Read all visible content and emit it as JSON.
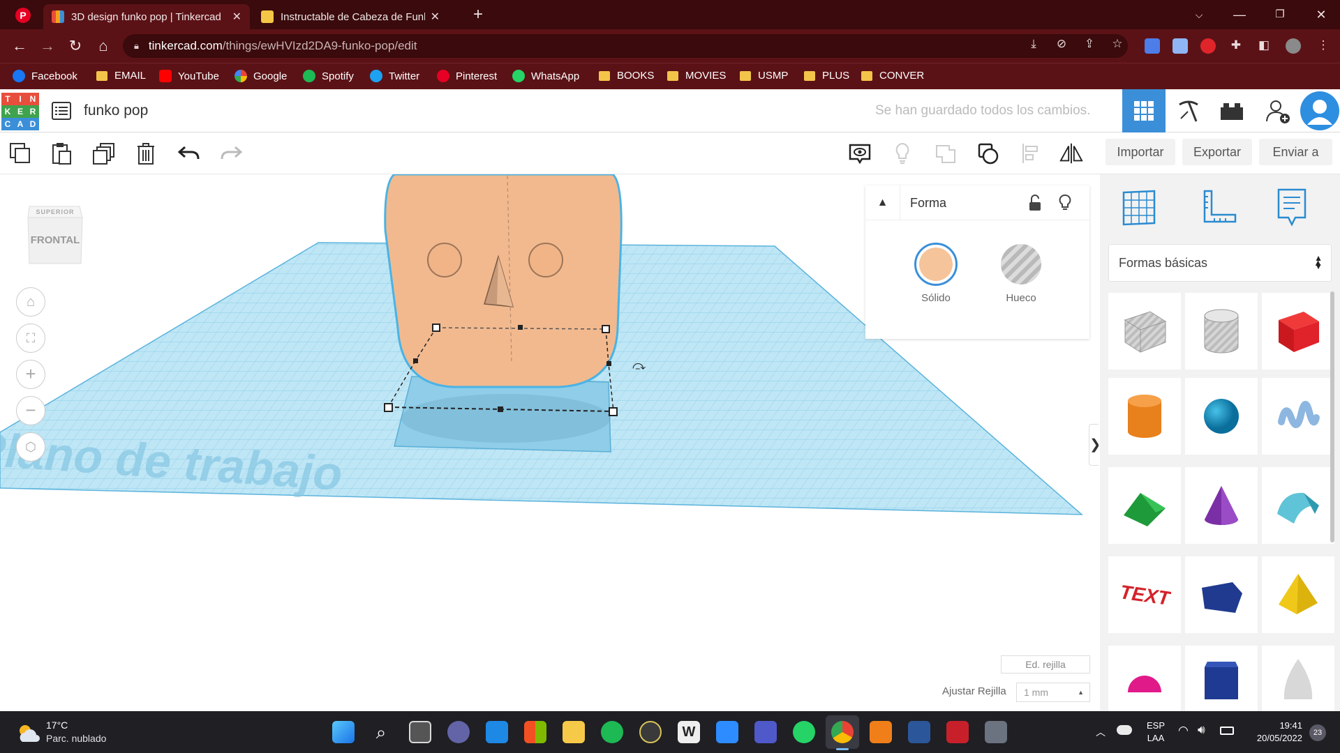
{
  "browser": {
    "tabs": [
      {
        "title": "3D design funko pop | Tinkercad",
        "active": true
      },
      {
        "title": "Instructable de Cabeza de Funko",
        "active": false
      }
    ],
    "url_host": "tinkercad.com",
    "url_path": "/things/ewHVIzd2DA9-funko-pop/edit",
    "bookmarks": [
      {
        "label": "Facebook",
        "icon": "facebook-icon",
        "color": "#1877f2"
      },
      {
        "label": "EMAIL",
        "icon": "folder-icon",
        "color": "#f2c44a"
      },
      {
        "label": "YouTube",
        "icon": "youtube-icon",
        "color": "#ff0000"
      },
      {
        "label": "Google",
        "icon": "google-icon",
        "color": "#ffffff"
      },
      {
        "label": "Spotify",
        "icon": "spotify-icon",
        "color": "#1db954"
      },
      {
        "label": "Twitter",
        "icon": "twitter-icon",
        "color": "#1da1f2"
      },
      {
        "label": "Pinterest",
        "icon": "pinterest-icon",
        "color": "#e60023"
      },
      {
        "label": "WhatsApp",
        "icon": "whatsapp-icon",
        "color": "#25d366"
      },
      {
        "label": "BOOKS",
        "icon": "folder-icon",
        "color": "#f2c44a"
      },
      {
        "label": "MOVIES",
        "icon": "folder-icon",
        "color": "#f2c44a"
      },
      {
        "label": "USMP",
        "icon": "folder-icon",
        "color": "#f2c44a"
      },
      {
        "label": "PLUS",
        "icon": "folder-icon",
        "color": "#f2c44a"
      },
      {
        "label": "CONVER",
        "icon": "folder-icon",
        "color": "#f2c44a"
      }
    ]
  },
  "app": {
    "logo_letters": [
      "T",
      "I",
      "N",
      "K",
      "E",
      "R",
      "C",
      "A",
      "D"
    ],
    "design_name": "funko pop",
    "save_status": "Se han guardado todos los cambios.",
    "toolbar": {
      "import": "Importar",
      "export": "Exportar",
      "send": "Enviar a"
    },
    "viewcube": {
      "top": "SUPERIOR",
      "front": "FRONTAL"
    },
    "workplane_label": "Plano de trabajo",
    "shape_panel": {
      "title": "Forma",
      "solid_label": "Sólido",
      "hole_label": "Hueco",
      "solid_color": "#f6c49a"
    },
    "library": {
      "category": "Formas básicas"
    },
    "grid": {
      "edit_label": "Ed. rejilla",
      "snap_label": "Ajustar Rejilla",
      "snap_value": "1 mm"
    }
  },
  "taskbar": {
    "weather_temp": "17°C",
    "weather_desc": "Parc. nublado",
    "lang_1": "ESP",
    "lang_2": "LAA",
    "time": "19:41",
    "date": "20/05/2022",
    "notifications": "23"
  },
  "colors": {
    "accent": "#5b1216",
    "tinkercad_blue": "#3b8fd8",
    "workplane": "#9fd7ee"
  }
}
